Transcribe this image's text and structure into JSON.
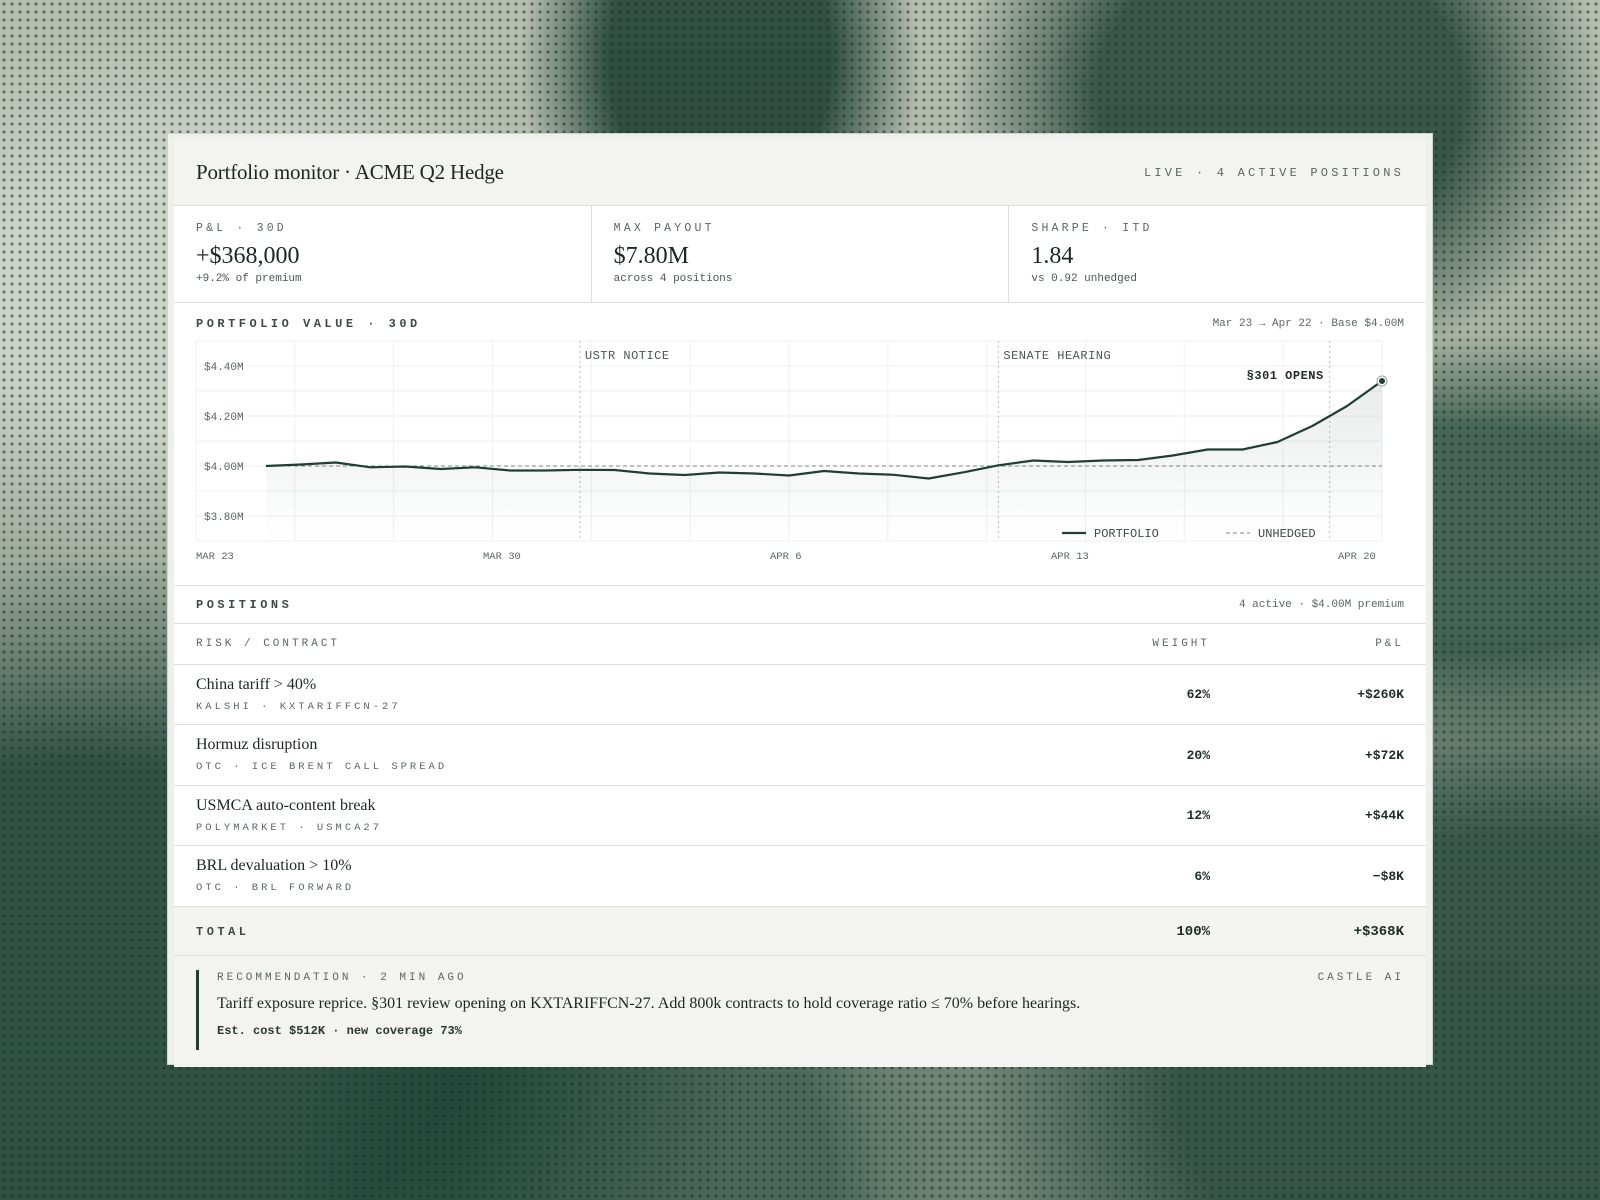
{
  "header": {
    "title": "Portfolio monitor · ACME Q2 Hedge",
    "status": "LIVE · 4 ACTIVE POSITIONS"
  },
  "kpis": [
    {
      "label": "P&L · 30D",
      "value": "+$368,000",
      "sub": "+9.2% of premium"
    },
    {
      "label": "MAX PAYOUT",
      "value": "$7.80M",
      "sub": "across 4 positions"
    },
    {
      "label": "SHARPE · ITD",
      "value": "1.84",
      "sub": "vs 0.92 unhedged"
    }
  ],
  "chart_section": {
    "label": "PORTFOLIO VALUE · 30D",
    "range": "Mar 23 → Apr 22 · Base $4.00M"
  },
  "chart_data": {
    "type": "line",
    "x": [
      "Mar 23",
      "Mar 24",
      "Mar 25",
      "Mar 26",
      "Mar 27",
      "Mar 28",
      "Mar 29",
      "Mar 30",
      "Mar 31",
      "Apr 1",
      "Apr 2",
      "Apr 3",
      "Apr 4",
      "Apr 5",
      "Apr 6",
      "Apr 7",
      "Apr 8",
      "Apr 9",
      "Apr 10",
      "Apr 11",
      "Apr 12",
      "Apr 13",
      "Apr 14",
      "Apr 15",
      "Apr 16",
      "Apr 17",
      "Apr 18",
      "Apr 19",
      "Apr 20",
      "Apr 21",
      "Apr 22"
    ],
    "series": [
      {
        "name": "PORTFOLIO",
        "values": [
          4.0,
          4.006,
          4.014,
          3.995,
          3.998,
          3.988,
          3.995,
          3.982,
          3.982,
          3.985,
          3.984,
          3.97,
          3.964,
          3.974,
          3.97,
          3.962,
          3.98,
          3.97,
          3.965,
          3.95,
          3.975,
          4.003,
          4.022,
          4.016,
          4.022,
          4.024,
          4.042,
          4.066,
          4.066,
          4.096,
          4.16,
          4.24,
          4.34
        ]
      },
      {
        "name": "UNHEDGED",
        "values": [
          4.0,
          4.0
        ]
      }
    ],
    "ytick_labels": [
      "$4.40M",
      "$4.20M",
      "$4.00M",
      "$3.80M"
    ],
    "yticks": [
      4.4,
      4.2,
      4.0,
      3.8
    ],
    "xtick_labels": [
      "MAR 23",
      "MAR 30",
      "APR 6",
      "APR 13",
      "APR 20"
    ],
    "ylim": [
      3.7,
      4.5
    ],
    "annotations": [
      {
        "label": "USTR NOTICE",
        "at": 9
      },
      {
        "label": "SENATE HEARING",
        "at": 21
      },
      {
        "label": "§301 OPENS",
        "at": 30.5
      }
    ],
    "legend": [
      "PORTFOLIO",
      "UNHEDGED"
    ],
    "legend_position": "bottom-right",
    "grid": true,
    "colors": {
      "line": "#1f3f34",
      "baseline": "#7d8580"
    }
  },
  "positions": {
    "label": "POSITIONS",
    "meta": "4 active · $4.00M premium",
    "columns": [
      "RISK / CONTRACT",
      "WEIGHT",
      "P&L"
    ],
    "rows": [
      {
        "risk": "China tariff > 40%",
        "contract": "KALSHI · KXTARIFFCN-27",
        "weight": "62%",
        "pnl": "+$260K"
      },
      {
        "risk": "Hormuz disruption",
        "contract": "OTC · ICE BRENT CALL SPREAD",
        "weight": "20%",
        "pnl": "+$72K"
      },
      {
        "risk": "USMCA auto-content break",
        "contract": "POLYMARKET · USMCA27",
        "weight": "12%",
        "pnl": "+$44K"
      },
      {
        "risk": "BRL devaluation > 10%",
        "contract": "OTC · BRL FORWARD",
        "weight": "6%",
        "pnl": "−$8K"
      }
    ],
    "total": {
      "label": "TOTAL",
      "weight": "100%",
      "pnl": "+$368K"
    }
  },
  "recommendation": {
    "label": "RECOMMENDATION · 2 MIN AGO",
    "source": "CASTLE AI",
    "text": "Tariff exposure reprice. §301 review opening on KXTARIFFCN-27. Add 800k contracts to hold coverage ratio ≤ 70% before hearings.",
    "footer": "Est. cost $512K · new coverage 73%"
  }
}
